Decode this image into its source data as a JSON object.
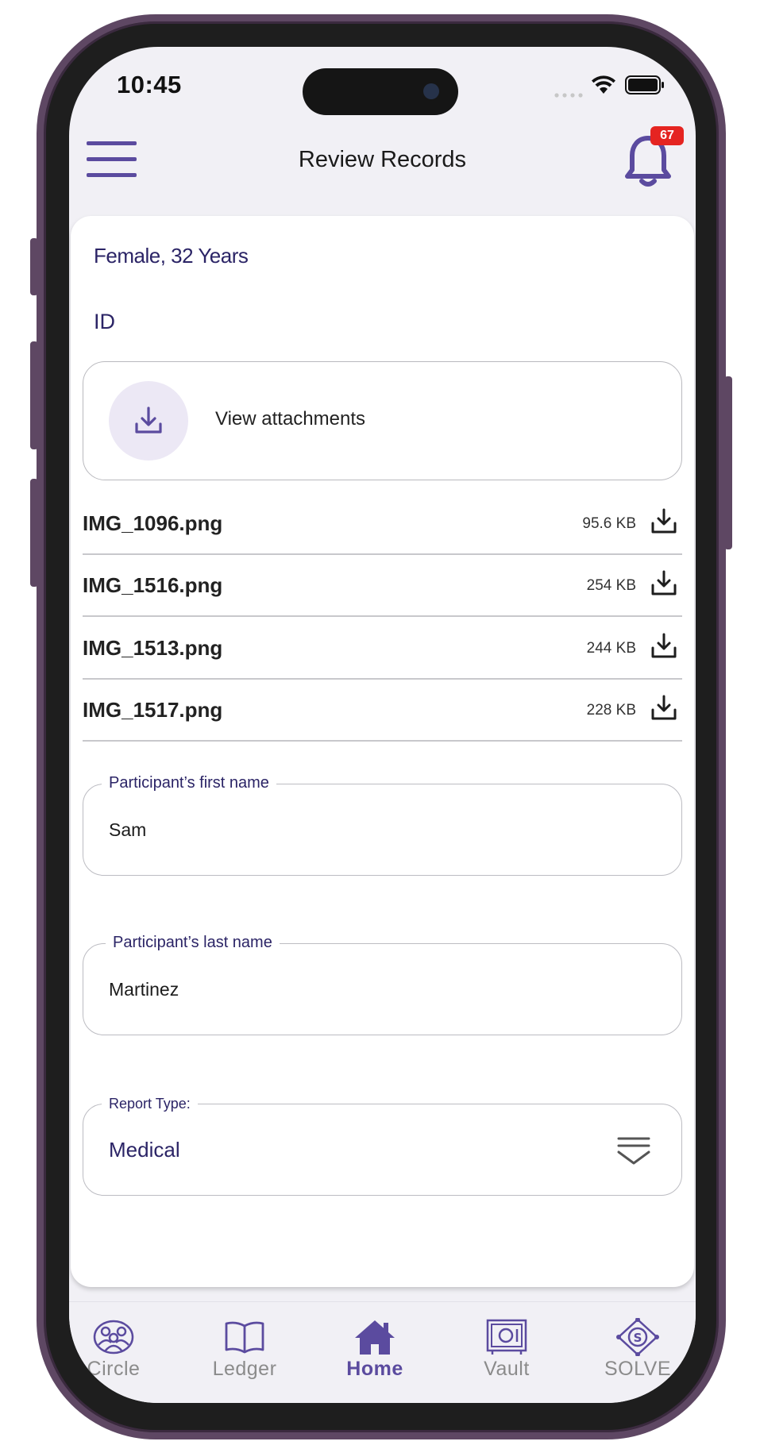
{
  "status_bar": {
    "time": "10:45"
  },
  "header": {
    "title": "Review Records",
    "notification_count": "67"
  },
  "record": {
    "demographics": "Female, 32 Years",
    "id_label": "ID",
    "attachments_label": "View attachments",
    "files": [
      {
        "name": "IMG_1096.png",
        "size": "95.6 KB"
      },
      {
        "name": "IMG_1516.png",
        "size": "254 KB"
      },
      {
        "name": "IMG_1513.png",
        "size": "244 KB"
      },
      {
        "name": "IMG_1517.png",
        "size": "228 KB"
      }
    ]
  },
  "form": {
    "first_name": {
      "label": "Participant’s first name",
      "value": "Sam"
    },
    "last_name": {
      "label": "Participant’s last name",
      "value": "Martinez"
    },
    "report_type": {
      "label": "Report Type:",
      "value": "Medical"
    }
  },
  "tabbar": {
    "tabs": [
      {
        "label": "Circle",
        "icon": "circle-people-icon"
      },
      {
        "label": "Ledger",
        "icon": "book-icon"
      },
      {
        "label": "Home",
        "icon": "home-icon",
        "active": true
      },
      {
        "label": "Vault",
        "icon": "vault-safe-icon"
      },
      {
        "label": "SOLVE",
        "icon": "solve-diamond-icon"
      }
    ]
  },
  "colors": {
    "accent": "#5b4b9f",
    "text_dark_purple": "#2b2466",
    "badge_red": "#e52421",
    "frame": "#5e4763"
  }
}
